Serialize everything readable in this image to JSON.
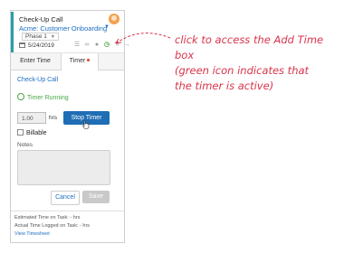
{
  "task": {
    "title": "Check-Up Call",
    "client_project": "Acme: Customer Onboarding",
    "phase": "Phase 1",
    "date": "5/24/2019"
  },
  "toolbar": {
    "icons": [
      "list-icon",
      "link-icon",
      "chat-icon",
      "timer-icon",
      "edit-icon",
      "forward-arrow-icon"
    ]
  },
  "tabs": [
    {
      "label": "Enter Time"
    },
    {
      "label": "Timer",
      "active": true
    }
  ],
  "timer": {
    "task_link": "Check-Up Call",
    "status": "Timer Running",
    "hours_value": "1.00",
    "hours_unit": "hrs",
    "stop_label": "Stop Timer",
    "billable_label": "Billable",
    "notes_label": "Notes",
    "cancel_label": "Cancel",
    "save_label": "Save"
  },
  "footer": {
    "estimated": "Estimated Time on Task: - hrs",
    "actual": "Actual Time Logged on Task: - hrs",
    "view_timesheet": "View Timesheet"
  },
  "annotation": {
    "line1": "click to access the Add Time box",
    "line2": "(green icon indicates that",
    "line3": "the timer is active)"
  },
  "colors": {
    "accent": "#2a9fa7",
    "link": "#1b6ec2",
    "active_timer": "#49a845",
    "primary_button": "#1f6db5",
    "annotation": "#d9334a"
  }
}
